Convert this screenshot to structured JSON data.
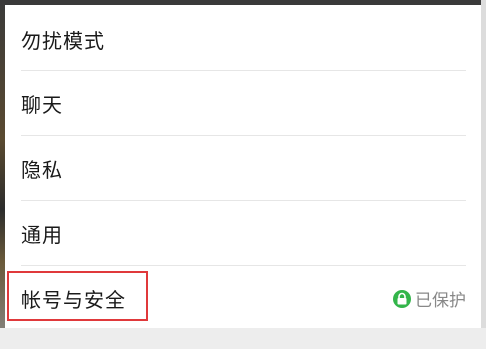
{
  "menu": {
    "items": [
      {
        "label": "勿扰模式"
      },
      {
        "label": "聊天"
      },
      {
        "label": "隐私"
      },
      {
        "label": "通用"
      },
      {
        "label": "帐号与安全",
        "status": "已保护",
        "status_icon": "lock-icon",
        "highlighted": true
      }
    ]
  },
  "colors": {
    "highlight_border": "#e0393b",
    "status_icon": "#33b54a",
    "status_text": "#888888"
  }
}
